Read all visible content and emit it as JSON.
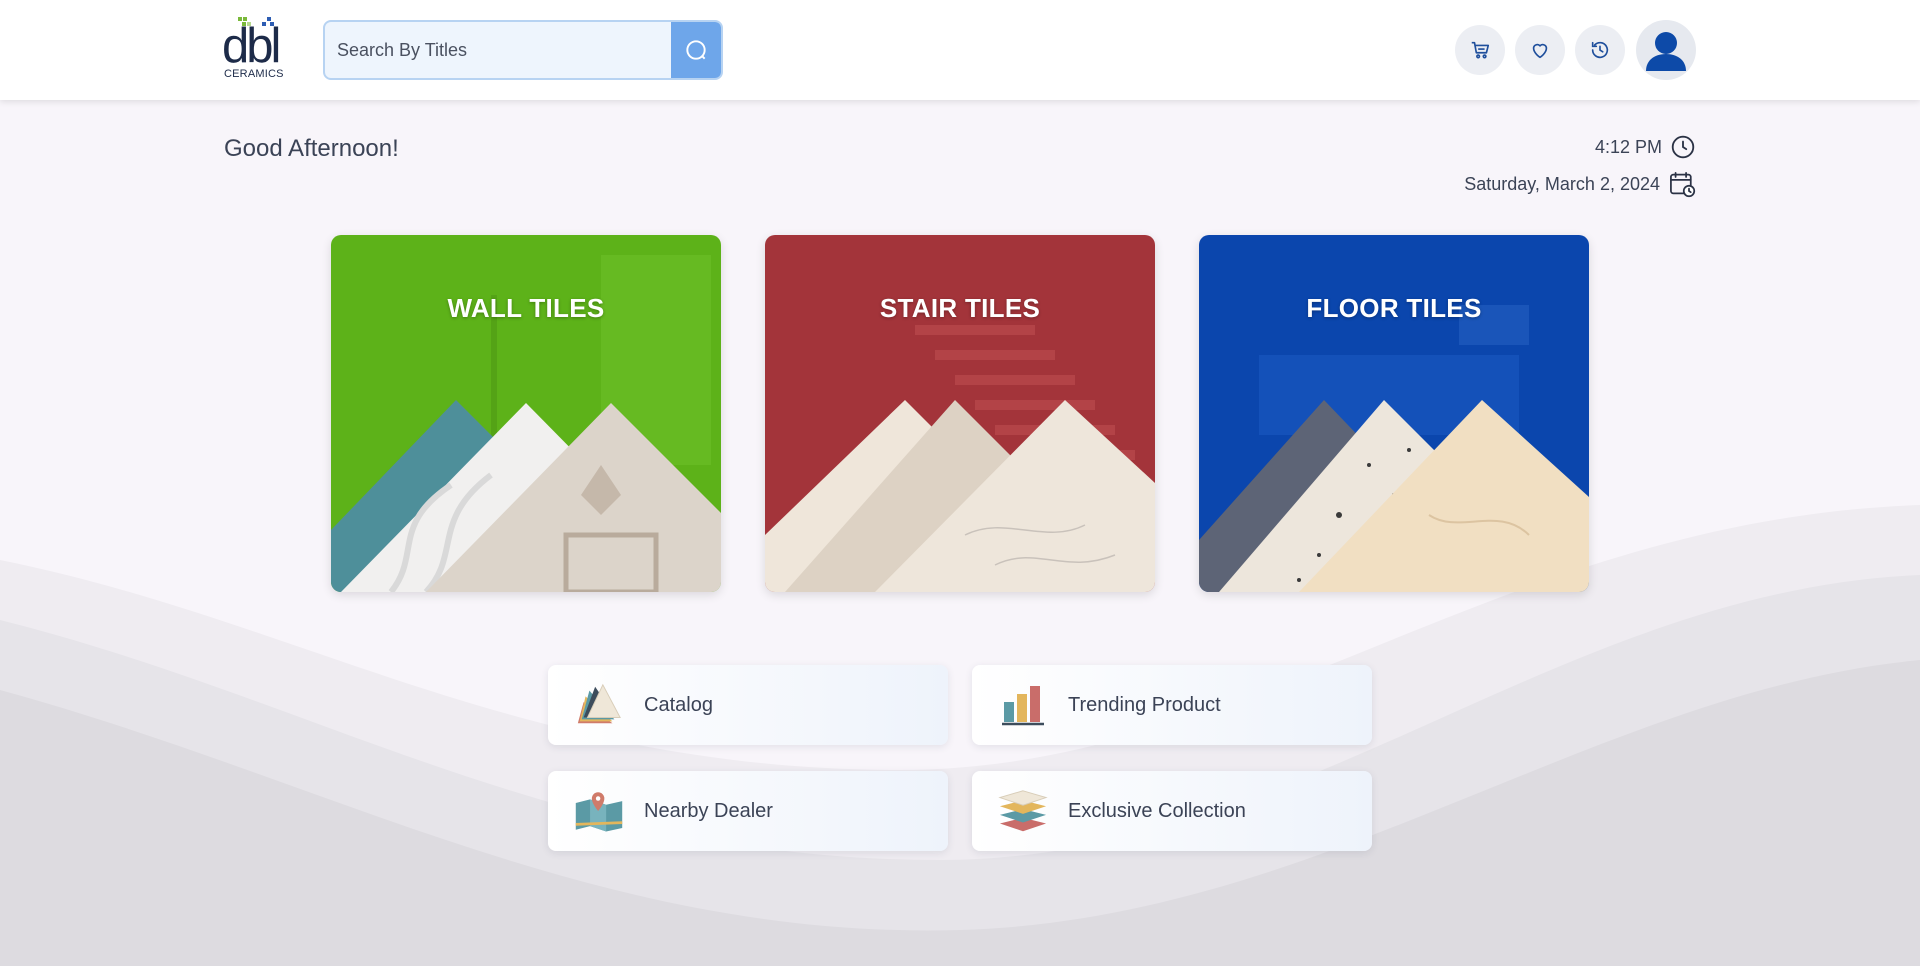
{
  "header": {
    "logo_text": "dbl",
    "logo_sub": "CERAMICS",
    "search": {
      "placeholder": "Search By Titles",
      "value": ""
    },
    "actions": [
      {
        "name": "cart",
        "icon": "cart-icon"
      },
      {
        "name": "wishlist",
        "icon": "heart-icon"
      },
      {
        "name": "history",
        "icon": "history-icon"
      },
      {
        "name": "profile",
        "icon": "user-icon"
      }
    ]
  },
  "greeting": "Good Afternoon!",
  "time": "4:12 PM",
  "date": "Saturday, March 2, 2024",
  "categories": [
    {
      "title": "WALL TILES",
      "color": "#5fb51a"
    },
    {
      "title": "STAIR TILES",
      "color": "#a8383a"
    },
    {
      "title": "FLOOR TILES",
      "color": "#0c4ab3"
    }
  ],
  "quick_links": [
    {
      "label": "Catalog",
      "icon": "swatch-fan-icon"
    },
    {
      "label": "Trending Product",
      "icon": "bar-chart-icon"
    },
    {
      "label": "Nearby Dealer",
      "icon": "map-pin-icon"
    },
    {
      "label": "Exclusive Collection",
      "icon": "layers-icon"
    }
  ],
  "colors": {
    "accent": "#6ea6ea",
    "text": "#3b4356",
    "brand_navy": "#1d2b49",
    "brand_green": "#7ab93a"
  }
}
